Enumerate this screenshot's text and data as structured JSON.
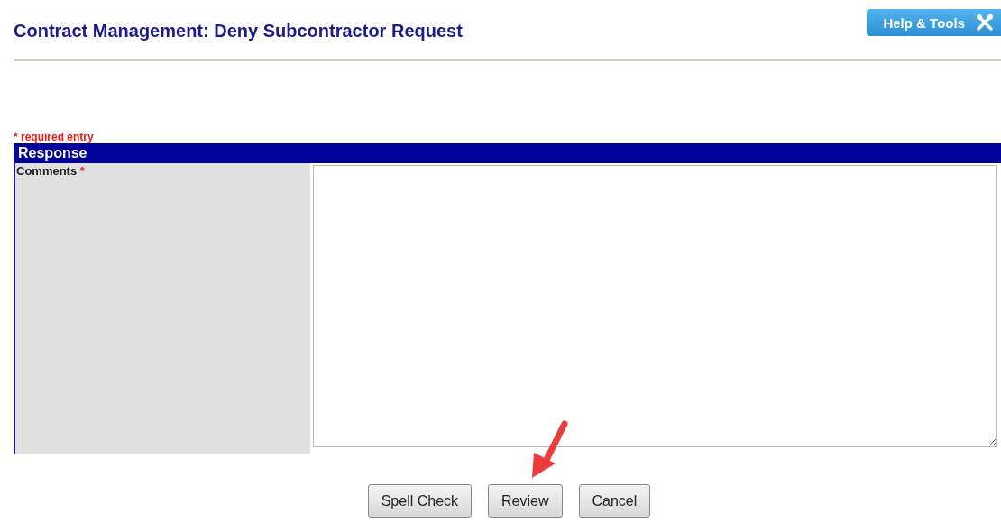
{
  "header": {
    "title": "Contract Management: Deny Subcontractor Request",
    "help_button": "Help & Tools"
  },
  "required_note": {
    "mark": "*",
    "text": "required entry"
  },
  "section": {
    "title": "Response",
    "fields": [
      {
        "label": "Comments",
        "required_mark": "*"
      }
    ]
  },
  "buttons": [
    {
      "label": "Spell Check"
    },
    {
      "label": "Review"
    },
    {
      "label": "Cancel"
    }
  ]
}
